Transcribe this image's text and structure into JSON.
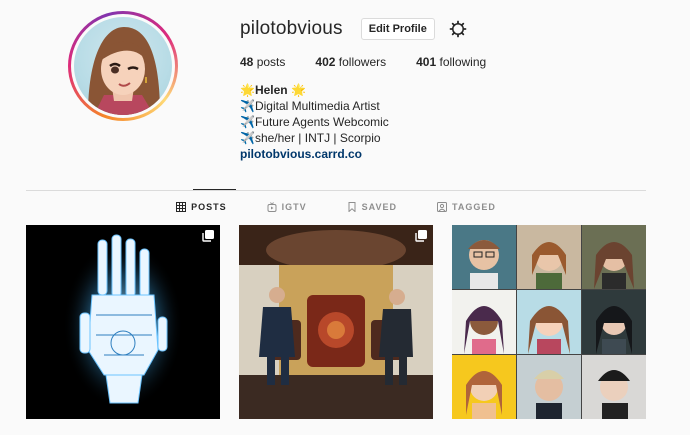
{
  "profile": {
    "username": "pilotobvious",
    "edit_profile_label": "Edit Profile",
    "stats": {
      "posts_count": "48",
      "posts_label": "posts",
      "followers_count": "402",
      "followers_label": "followers",
      "following_count": "401",
      "following_label": "following"
    },
    "bio": {
      "name": "🌟Helen 🌟",
      "line1": "✈️Digital Multimedia Artist",
      "line2": "✈️Future Agents Webcomic",
      "line3": "✈️she/her | INTJ | Scorpio",
      "link": "pilotobvious.carrd.co"
    }
  },
  "tabs": [
    {
      "label": "POSTS",
      "icon": "grid-icon",
      "active": true
    },
    {
      "label": "IGTV",
      "icon": "igtv-icon",
      "active": false
    },
    {
      "label": "SAVED",
      "icon": "bookmark-icon",
      "active": false
    },
    {
      "label": "TAGGED",
      "icon": "tagged-icon",
      "active": false
    }
  ],
  "posts": [
    {
      "description": "glowing robotic hand on black background",
      "multiple": true
    },
    {
      "description": "two men in suits seated in a curtained room",
      "multiple": true
    },
    {
      "description": "grid of nine character portraits",
      "multiple": false
    }
  ],
  "colors": {
    "link": "#00376b",
    "divider": "#dbdbdb",
    "muted": "#8e8e8e",
    "text": "#262626"
  }
}
